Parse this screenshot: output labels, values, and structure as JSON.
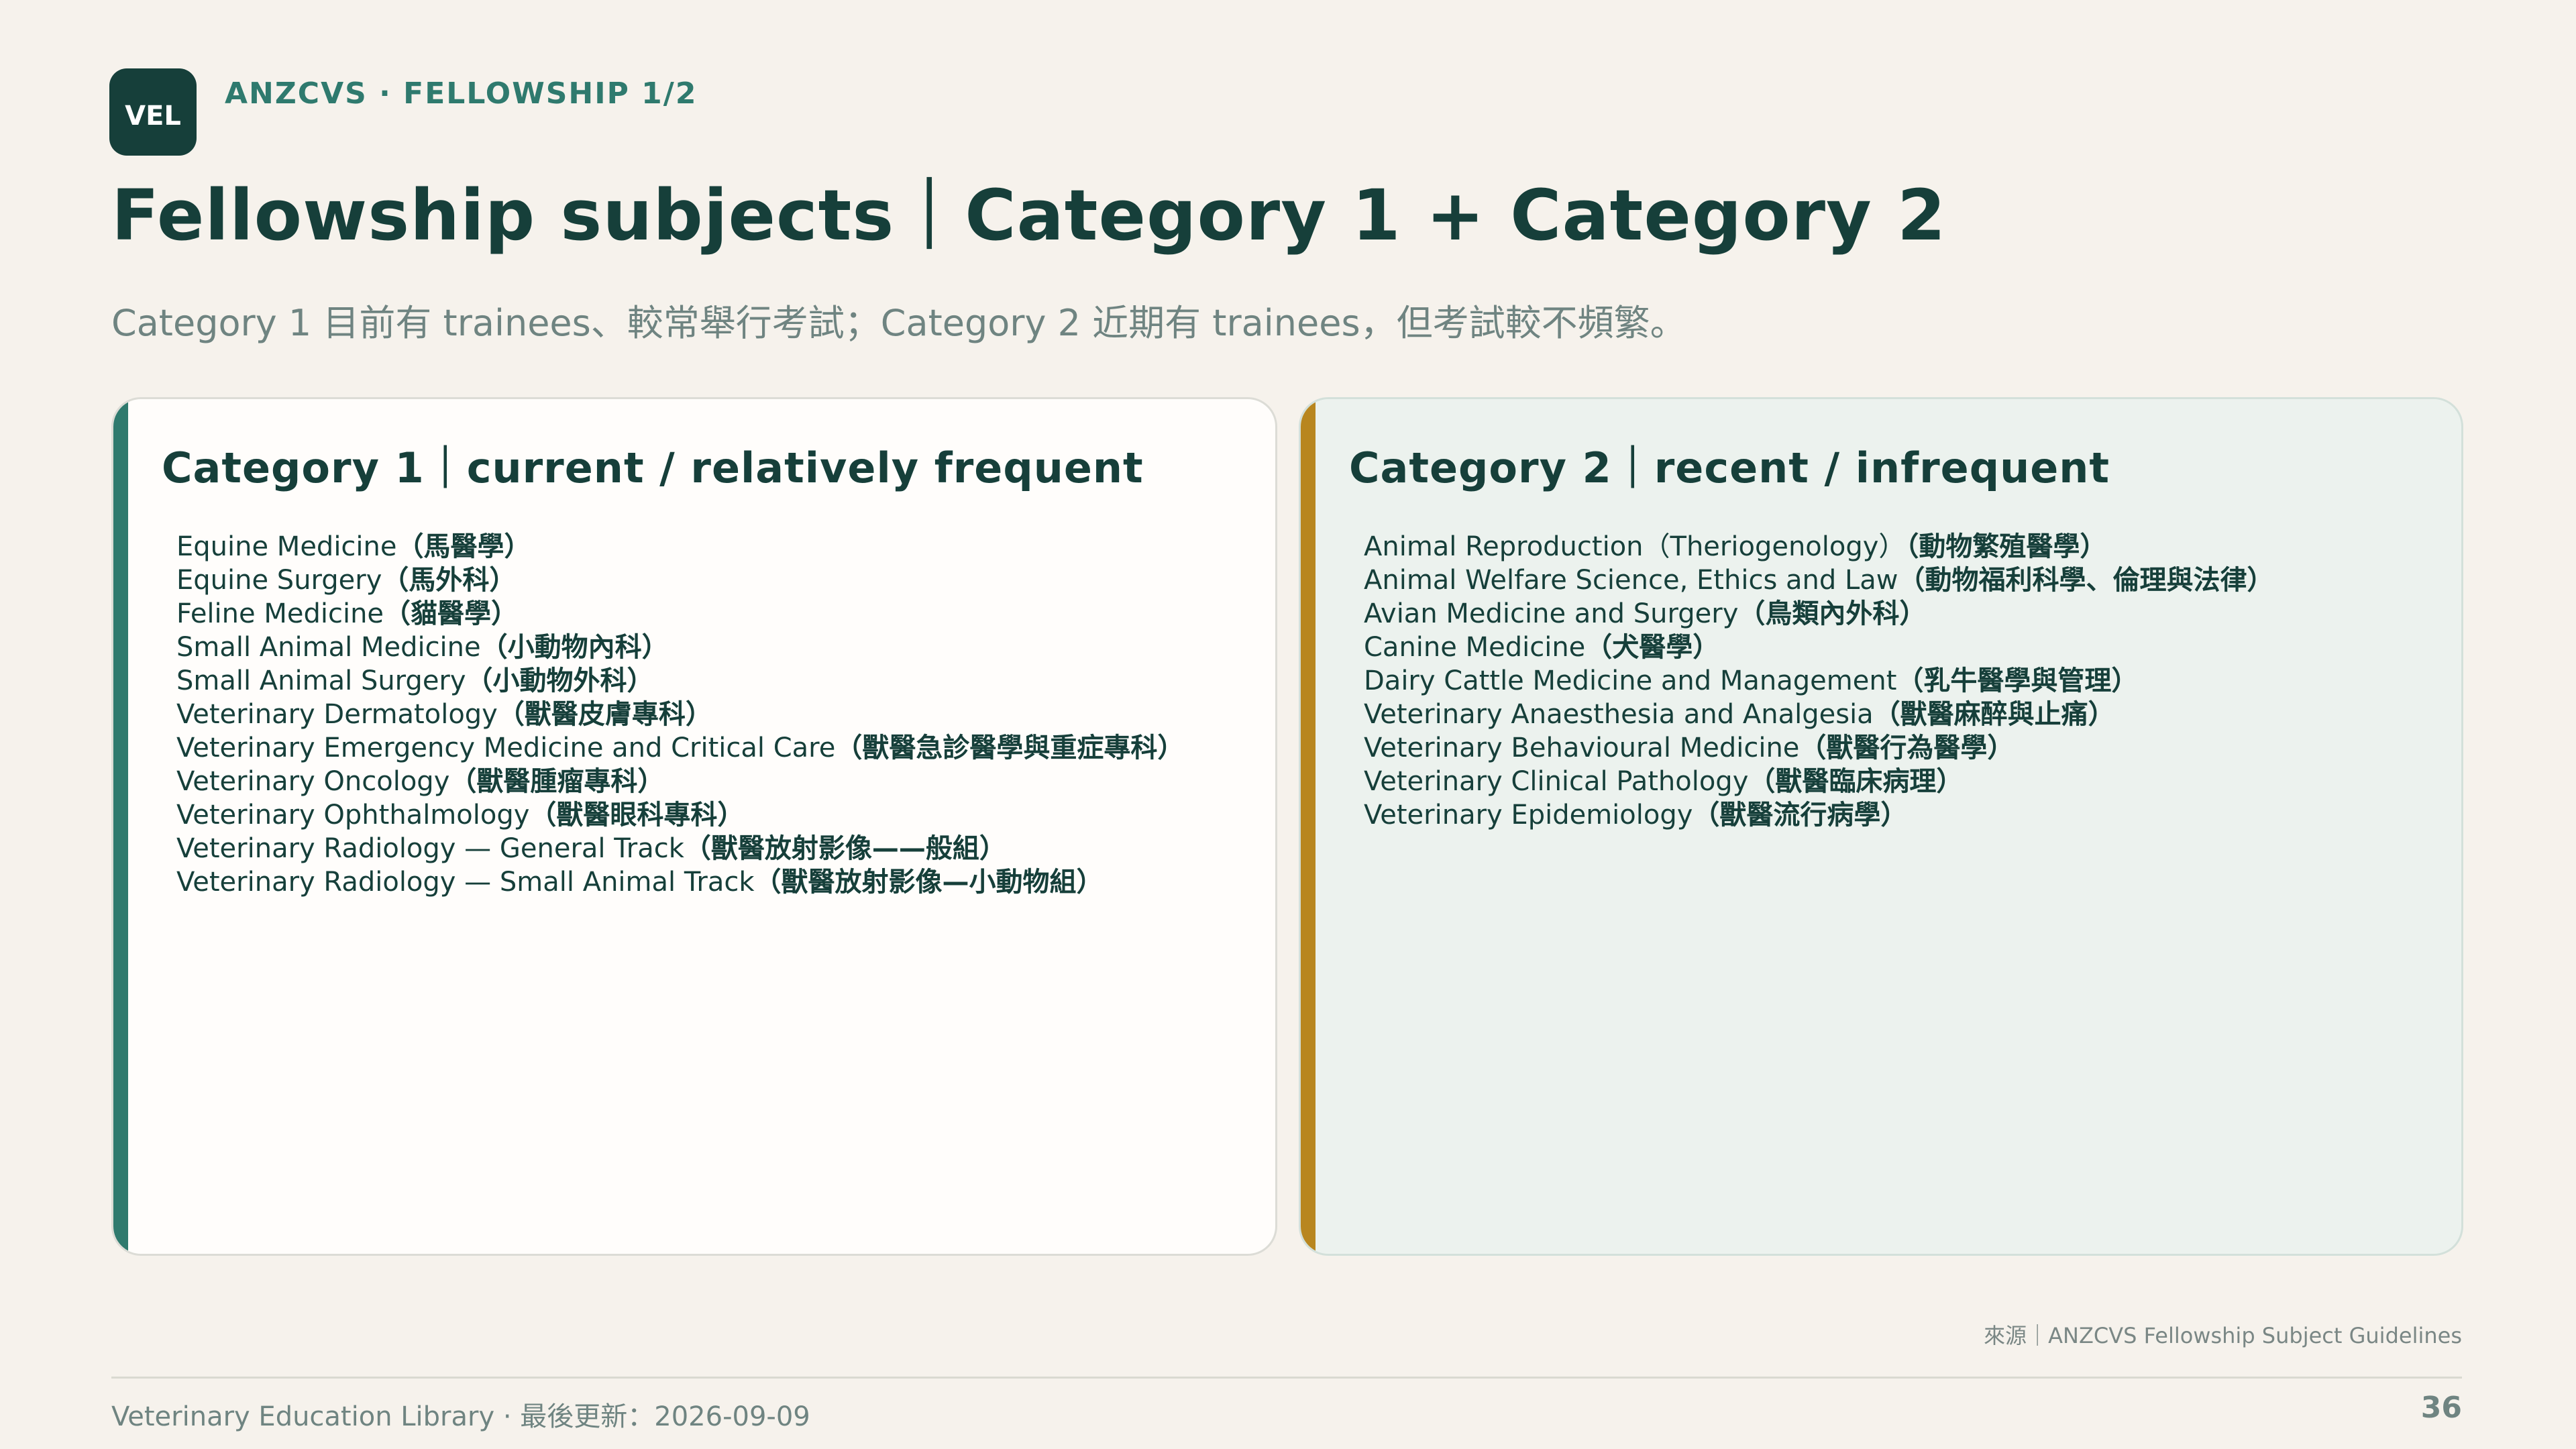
{
  "header": {
    "logo_text": "VEL",
    "kicker": "ANZCVS · FELLOWSHIP 1/2",
    "title": "Fellowship subjects｜Category 1 + Category 2",
    "subtitle": "Category 1 目前有 trainees、較常舉行考試；Category 2 近期有 trainees，但考試較不頻繁。"
  },
  "category1": {
    "title": "Category 1｜current / relatively frequent",
    "accent_color": "#2f7a6e",
    "items": [
      {
        "en": "Equine Medicine",
        "zh": "（馬醫學）"
      },
      {
        "en": "Equine Surgery",
        "zh": "（馬外科）"
      },
      {
        "en": "Feline Medicine",
        "zh": "（貓醫學）"
      },
      {
        "en": "Small Animal Medicine",
        "zh": "（小動物內科）"
      },
      {
        "en": "Small Animal Surgery",
        "zh": "（小動物外科）"
      },
      {
        "en": "Veterinary Dermatology",
        "zh": "（獸醫皮膚專科）"
      },
      {
        "en": "Veterinary Emergency Medicine and Critical Care",
        "zh": "（獸醫急診醫學與重症專科）"
      },
      {
        "en": "Veterinary Oncology",
        "zh": "（獸醫腫瘤專科）"
      },
      {
        "en": "Veterinary Ophthalmology",
        "zh": "（獸醫眼科專科）"
      },
      {
        "en": "Veterinary Radiology — General Track",
        "zh": "（獸醫放射影像——般組）"
      },
      {
        "en": "Veterinary Radiology — Small Animal Track",
        "zh": "（獸醫放射影像—小動物組）"
      }
    ]
  },
  "category2": {
    "title": "Category 2｜recent / infrequent",
    "accent_color": "#b8861f",
    "items": [
      {
        "en": "Animal Reproduction（Theriogenology）",
        "zh": "（動物繁殖醫學）"
      },
      {
        "en": "Animal Welfare Science, Ethics and Law",
        "zh": "（動物福利科學、倫理與法律）"
      },
      {
        "en": "Avian Medicine and Surgery",
        "zh": "（鳥類內外科）"
      },
      {
        "en": "Canine Medicine",
        "zh": "（犬醫學）"
      },
      {
        "en": "Dairy Cattle Medicine and Management",
        "zh": "（乳牛醫學與管理）"
      },
      {
        "en": "Veterinary Anaesthesia and Analgesia",
        "zh": "（獸醫麻醉與止痛）"
      },
      {
        "en": "Veterinary Behavioural Medicine",
        "zh": "（獸醫行為醫學）"
      },
      {
        "en": "Veterinary Clinical Pathology",
        "zh": "（獸醫臨床病理）"
      },
      {
        "en": "Veterinary Epidemiology",
        "zh": "（獸醫流行病學）"
      }
    ]
  },
  "footer": {
    "source": "來源｜ANZCVS Fellowship Subject Guidelines",
    "left_text": "Veterinary Education Library · 最後更新：2026-09-09",
    "page_number": "36"
  }
}
